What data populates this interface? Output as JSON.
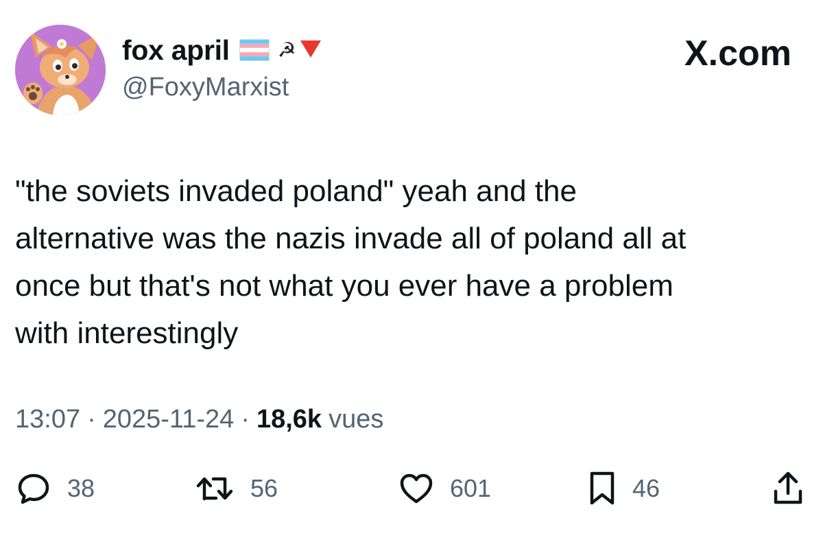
{
  "user": {
    "display_name": "fox april",
    "handle": "@FoxyMarxist",
    "name_emojis": [
      "trans-flag-icon",
      "hammer-sickle-icon",
      "red-triangle-icon"
    ]
  },
  "brand": {
    "label": "X.com"
  },
  "tweet": {
    "text": "\"the soviets invaded poland\" yeah and the\nalternative was the nazis invade all of poland all at\nonce but that's not what you ever have a problem\nwith interestingly"
  },
  "meta": {
    "time": "13:07",
    "separator": "·",
    "date": "2025-11-24",
    "views_count": "18,6k",
    "views_label": "vues"
  },
  "actions": {
    "replies": "38",
    "retweets": "56",
    "likes": "601",
    "bookmarks": "46"
  },
  "colors": {
    "text_primary": "#0f1419",
    "text_secondary": "#536471",
    "avatar_bg": "#c07ad6",
    "trans_blue": "#5bcefa",
    "trans_pink": "#f5a9b8",
    "red_triangle": "#e8372b"
  }
}
